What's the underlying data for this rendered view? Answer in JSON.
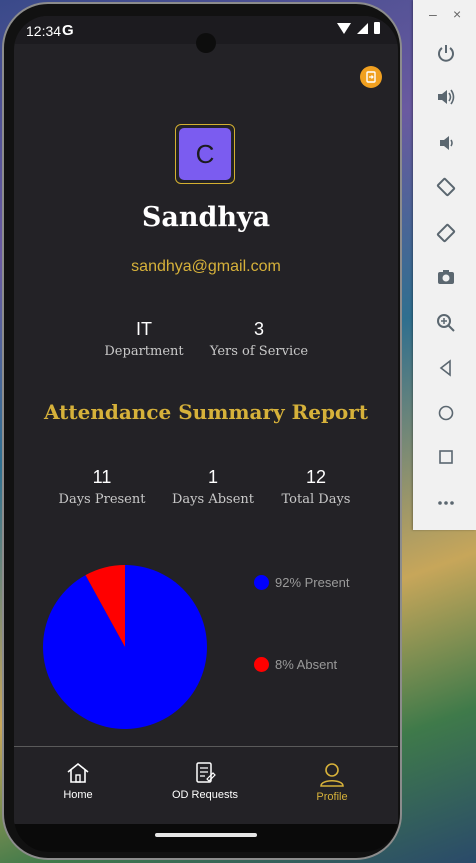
{
  "status_bar": {
    "time": "12:34",
    "g_label": "G"
  },
  "profile": {
    "avatar_letter": "C",
    "name": "Sandhya",
    "email": "sandhya@gmail.com",
    "stats": [
      {
        "value": "IT",
        "label": "Department"
      },
      {
        "value": "3",
        "label": "Yers of Service"
      }
    ]
  },
  "attendance": {
    "title": "Attendance Summary Report",
    "stats": [
      {
        "value": "11",
        "label": "Days Present"
      },
      {
        "value": "1",
        "label": "Days Absent"
      },
      {
        "value": "12",
        "label": "Total Days"
      }
    ],
    "legend": [
      {
        "label": "92% Present",
        "color": "#0000ff"
      },
      {
        "label": "8% Absent",
        "color": "#ff0000"
      }
    ]
  },
  "chart_data": {
    "type": "pie",
    "categories": [
      "Present",
      "Absent"
    ],
    "values": [
      92,
      8
    ],
    "colors": [
      "#0000ff",
      "#ff0000"
    ]
  },
  "nav": {
    "items": [
      {
        "label": "Home",
        "icon": "home-icon",
        "active": false
      },
      {
        "label": "OD Requests",
        "icon": "document-icon",
        "active": false
      },
      {
        "label": "Profile",
        "icon": "profile-icon",
        "active": true
      }
    ]
  },
  "emulator_panel": {
    "minimize": "–",
    "close": "×",
    "buttons": [
      "power-icon",
      "volume-up-icon",
      "volume-down-icon",
      "rotate-left-icon",
      "rotate-right-icon",
      "camera-icon",
      "zoom-icon",
      "back-icon",
      "home-circle-icon",
      "overview-icon",
      "more-icon"
    ]
  },
  "colors": {
    "accent": "#d6b13a",
    "background": "#232226",
    "avatar": "#7b5cf0",
    "logout": "#f0a020"
  }
}
